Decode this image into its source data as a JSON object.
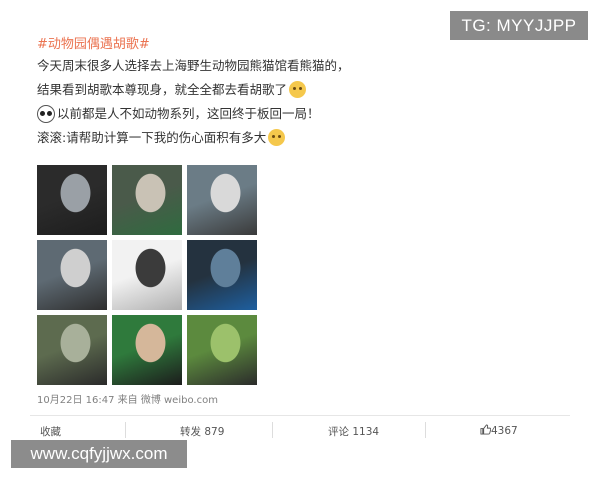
{
  "watermarks": {
    "top": "TG: MYYJJPP",
    "bottom": "www.cqfyjjwx.com"
  },
  "post": {
    "hashtag": "#动物园偶遇胡歌#",
    "lines": [
      "今天周末很多人选择去上海野生动物园熊猫馆看熊猫的，",
      "结果看到胡歌本尊现身，就全全都去看胡歌了",
      "以前都是人不如动物系列，这回终于板回一局！",
      "滚滚:请帮助计算一下我的伤心面积有多大"
    ],
    "emoji_names": [
      "smirk-emoji-icon",
      "panda-emoji-icon",
      "laugh-emoji-icon"
    ]
  },
  "photos": [
    {
      "name": "man-in-car",
      "colors": [
        "#2b2b2b",
        "#9aa0a6",
        "#1d1d1d"
      ]
    },
    {
      "name": "man-green-jacket",
      "colors": [
        "#4a5a4a",
        "#c9c2b5",
        "#2f6b3f"
      ]
    },
    {
      "name": "man-and-signs",
      "colors": [
        "#6b7c86",
        "#d9d9d9",
        "#3a3a3a"
      ]
    },
    {
      "name": "man-behind-bars",
      "colors": [
        "#5e6a73",
        "#cfcfcf",
        "#2e2e2e"
      ]
    },
    {
      "name": "screenshot-collage",
      "colors": [
        "#f2f2f2",
        "#3b3b3b",
        "#b0b0b0"
      ]
    },
    {
      "name": "bus-window",
      "colors": [
        "#24323f",
        "#5f7f9a",
        "#1e5fa0"
      ]
    },
    {
      "name": "crowd-outdoors",
      "colors": [
        "#5d6b4f",
        "#a8b09a",
        "#2a2a2a"
      ]
    },
    {
      "name": "smiling-man",
      "colors": [
        "#2f7a3c",
        "#d5b79a",
        "#1c1c1c"
      ]
    },
    {
      "name": "man-in-greenery",
      "colors": [
        "#5c8a3e",
        "#9cc16b",
        "#2b2b2b"
      ]
    }
  ],
  "meta": {
    "date": "10月22日 16:47",
    "source_prefix": "来自",
    "source": "微博 weibo.com"
  },
  "actions": {
    "collect": "收藏",
    "repost": "转发 879",
    "comment": "评论 1134",
    "like": "4367"
  }
}
